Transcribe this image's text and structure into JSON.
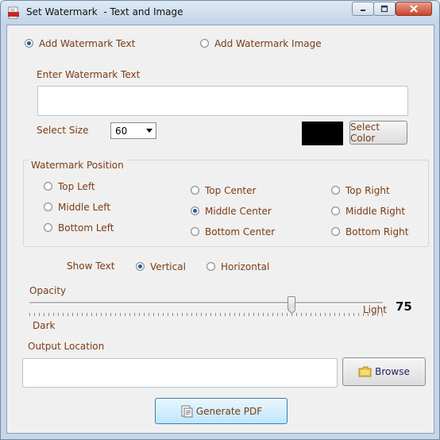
{
  "window": {
    "title": "Set Watermark  - Text and Image",
    "controls": {
      "minimize": "—",
      "maximize": "□",
      "close": "✕"
    }
  },
  "watermark_type": {
    "text_option": "Add Watermark Text",
    "image_option": "Add Watermark Image",
    "selected": "text"
  },
  "text_input": {
    "label": "Enter Watermark Text",
    "value": ""
  },
  "size": {
    "label": "Select Size",
    "value": "60"
  },
  "color": {
    "swatch_hex": "#000000",
    "button": "Select Color"
  },
  "position": {
    "group_label": "Watermark Position",
    "options": [
      "Top Left",
      "Middle Left",
      "Bottom Left",
      "Top Center",
      "Middle Center",
      "Bottom Center",
      "Top Right",
      "Middle Right",
      "Bottom Right"
    ],
    "selected": "Middle Center"
  },
  "orientation": {
    "label": "Show Text",
    "vertical": "Vertical",
    "horizontal": "Horizontal",
    "selected": "Vertical"
  },
  "opacity": {
    "label": "Opacity",
    "min_label": "Dark",
    "max_label": "Light",
    "value": "75"
  },
  "output": {
    "label": "Output Location",
    "value": "",
    "browse_button": "Browse"
  },
  "generate_button": "Generate PDF",
  "colors": {
    "label_text": "#7a3c14",
    "window_frame": "#c6d6e8",
    "client_bg": "#f0f0f0"
  }
}
